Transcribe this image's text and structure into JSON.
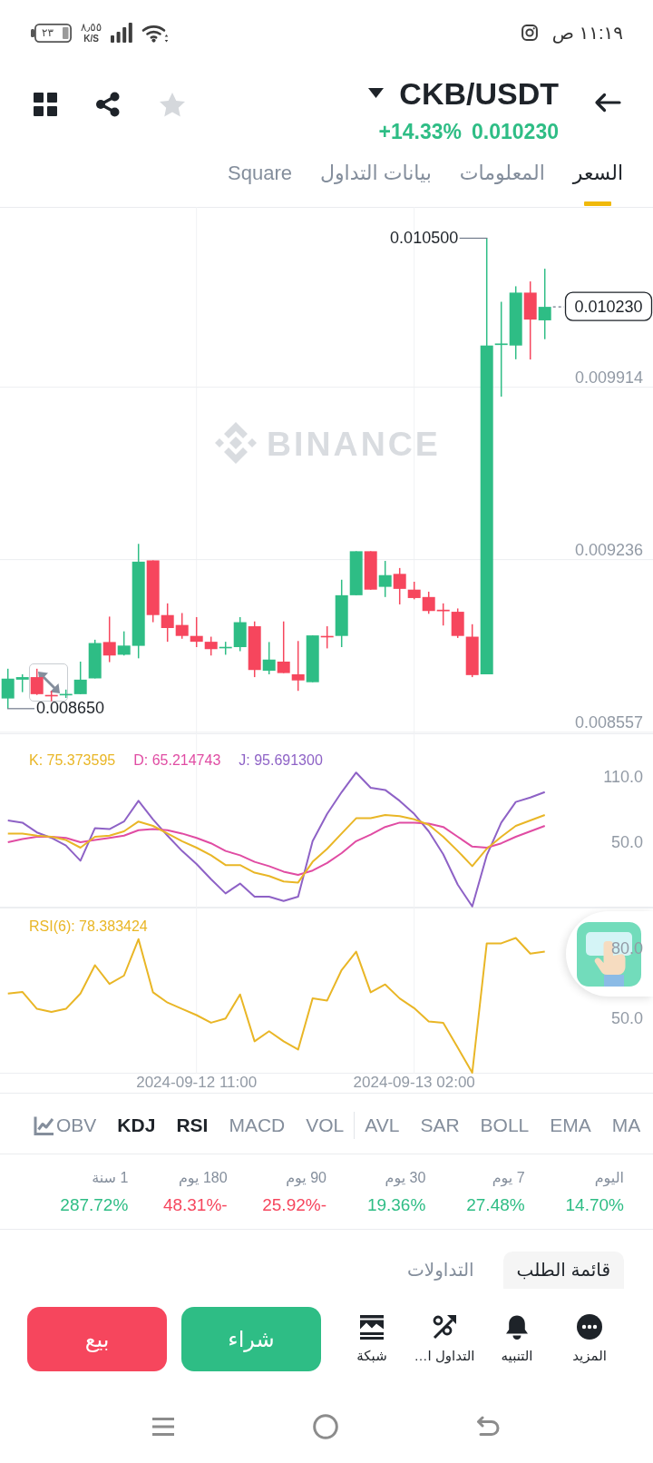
{
  "status_bar": {
    "time": "١١:١٩ ص",
    "battery": "٢٣",
    "network_speed": "٨٫٥٥",
    "network_speed_unit": "K/S"
  },
  "header": {
    "pair": "CKB/USDT",
    "change": "+14.33%",
    "price": "0.010230",
    "favorite": false
  },
  "tabs": [
    {
      "label": "السعر",
      "selected": true
    },
    {
      "label": "المعلومات",
      "selected": false
    },
    {
      "label": "بيانات التداول",
      "selected": false
    },
    {
      "label": "Square",
      "selected": false
    }
  ],
  "price_chart": {
    "watermark": "BINANCE",
    "high": "0.010500",
    "low": "0.008650",
    "last_price": "0.010230",
    "chart_data": {
      "type": "candlestick",
      "grid": true,
      "ylim": [
        0.008553,
        0.010623
      ],
      "yticks": [
        {
          "value": 0.009914,
          "label": "0.009914"
        },
        {
          "value": 0.009236,
          "label": "0.009236"
        },
        {
          "value": 0.008557,
          "label": "0.008557"
        }
      ],
      "ohlc": [
        [
          0.00869,
          0.008807,
          0.00865,
          0.008768
        ],
        [
          0.008764,
          0.008785,
          0.008715,
          0.008774
        ],
        [
          0.008774,
          0.008807,
          0.008704,
          0.008707
        ],
        [
          0.008704,
          0.00872,
          0.008679,
          0.0087
        ],
        [
          0.008704,
          0.008725,
          0.008692,
          0.008708
        ],
        [
          0.008707,
          0.008835,
          0.008707,
          0.008764
        ],
        [
          0.008769,
          0.008921,
          0.008769,
          0.008908
        ],
        [
          0.008912,
          0.009012,
          0.008833,
          0.008859
        ],
        [
          0.008862,
          0.008954,
          0.008859,
          0.008898
        ],
        [
          0.008897,
          0.009298,
          0.008848,
          0.009228
        ],
        [
          0.009233,
          0.009233,
          0.00899,
          0.009018
        ],
        [
          0.009018,
          0.009064,
          0.008913,
          0.008967
        ],
        [
          0.008979,
          0.009026,
          0.008925,
          0.008936
        ],
        [
          0.008936,
          0.00901,
          0.008892,
          0.008913
        ],
        [
          0.008913,
          0.008933,
          0.008859,
          0.008884
        ],
        [
          0.008888,
          0.008913,
          0.008862,
          0.008893
        ],
        [
          0.008892,
          0.00901,
          0.008876,
          0.00899
        ],
        [
          0.008974,
          0.008993,
          0.008774,
          0.008802
        ],
        [
          0.008799,
          0.008912,
          0.008785,
          0.008843
        ],
        [
          0.008835,
          0.008993,
          0.00879,
          0.00879
        ],
        [
          0.008785,
          0.008916,
          0.00872,
          0.008761
        ],
        [
          0.008754,
          0.008938,
          0.008754,
          0.008938
        ],
        [
          0.008936,
          0.008974,
          0.008887,
          0.008931
        ],
        [
          0.008936,
          0.009157,
          0.008892,
          0.009096
        ],
        [
          0.009096,
          0.009269,
          0.009096,
          0.009269
        ],
        [
          0.009269,
          0.009269,
          0.009118,
          0.009118
        ],
        [
          0.009129,
          0.009231,
          0.009089,
          0.009175
        ],
        [
          0.00918,
          0.009203,
          0.00906,
          0.009121
        ],
        [
          0.009118,
          0.009149,
          0.00908,
          0.009085
        ],
        [
          0.009089,
          0.00911,
          0.009023,
          0.009034
        ],
        [
          0.009039,
          0.009064,
          0.008977,
          0.009033
        ],
        [
          0.009031,
          0.009044,
          0.008928,
          0.008936
        ],
        [
          0.008933,
          0.008982,
          0.008774,
          0.008782
        ],
        [
          0.008785,
          0.0105,
          0.008785,
          0.010078
        ],
        [
          0.01008,
          0.01025,
          0.009877,
          0.010086
        ],
        [
          0.010078,
          0.010311,
          0.010024,
          0.010286
        ],
        [
          0.010286,
          0.01033,
          0.010023,
          0.01018
        ],
        [
          0.010177,
          0.01038,
          0.010103,
          0.01023
        ]
      ]
    }
  },
  "kdj": {
    "legend": [
      "J: 95.691300",
      "D: 65.214743",
      "K: 75.373595"
    ],
    "chart_data": {
      "type": "line",
      "grid": true,
      "ylim": [
        -10,
        150
      ],
      "yticks": [
        {
          "value": 50,
          "label": "50.0"
        },
        {
          "value": 110,
          "label": "110.0"
        }
      ],
      "series": [
        {
          "color": "#8e62c6",
          "values": [
            70,
            68,
            59,
            54,
            47,
            33,
            63,
            62,
            69,
            88,
            71,
            56,
            42,
            30,
            16,
            3,
            12,
            0,
            0,
            -4,
            0,
            51,
            76,
            96,
            114,
            100,
            98,
            88,
            76,
            60,
            39,
            11,
            -9,
            38,
            68,
            87,
            91,
            96
          ]
        },
        {
          "color": "#e04ca3",
          "values": [
            50,
            53,
            55,
            55,
            54,
            50,
            52,
            54,
            56,
            61,
            62,
            61,
            58,
            54,
            49,
            42,
            38,
            32,
            28,
            23,
            20,
            24,
            31,
            40,
            51,
            57,
            64,
            68,
            68,
            67,
            64,
            55,
            46,
            45,
            49,
            55,
            60,
            65
          ]
        },
        {
          "color": "#e9b626",
          "values": [
            58,
            58,
            56,
            55,
            52,
            45,
            55,
            56,
            60,
            69,
            65,
            58,
            51,
            45,
            38,
            29,
            29,
            22,
            19,
            14,
            13,
            32,
            44,
            58,
            72,
            72,
            75,
            74,
            71,
            66,
            55,
            42,
            28,
            44,
            55,
            65,
            70,
            75
          ]
        }
      ]
    }
  },
  "rsi": {
    "legend": "RSI(6): 78.383424",
    "chart_data": {
      "type": "line",
      "grid": true,
      "categories": [
        null,
        null,
        null,
        null,
        null,
        null,
        null,
        null,
        null,
        null,
        null,
        null,
        null,
        "2024-09-12 11:00",
        null,
        null,
        null,
        null,
        null,
        null,
        null,
        null,
        null,
        null,
        null,
        null,
        null,
        null,
        "2024-09-13 02:00",
        null,
        null,
        null,
        null,
        null,
        null,
        null,
        null,
        null
      ],
      "ylim": [
        25.9,
        97.4
      ],
      "yticks": [
        {
          "value": 50,
          "label": "50.0"
        },
        {
          "value": 80,
          "label": "80.0"
        }
      ],
      "series": [
        {
          "color": "#e9b626",
          "values": [
            60.4,
            61.1,
            53.8,
            52.5,
            53.8,
            60.4,
            72.6,
            64.5,
            68.1,
            83.8,
            60.9,
            56.5,
            53.8,
            51.1,
            47.8,
            49.6,
            60.0,
            39.8,
            44.2,
            39.8,
            36.3,
            58.3,
            57.4,
            70.5,
            78.4,
            60.9,
            64.3,
            58.3,
            54.1,
            48.4,
            47.8,
            37.1,
            26.3,
            82.0,
            82.0,
            84.3,
            77.6,
            78.4
          ]
        }
      ]
    }
  },
  "indicators": {
    "main": [
      {
        "label": "MA",
        "selected": false
      },
      {
        "label": "EMA",
        "selected": false
      },
      {
        "label": "BOLL",
        "selected": false
      },
      {
        "label": "SAR",
        "selected": false
      },
      {
        "label": "AVL",
        "selected": false
      }
    ],
    "sub": [
      {
        "label": "VOL",
        "selected": false
      },
      {
        "label": "MACD",
        "selected": false
      },
      {
        "label": "RSI",
        "selected": true
      },
      {
        "label": "KDJ",
        "selected": true
      },
      {
        "label": "OBV",
        "selected": false
      }
    ]
  },
  "performance": [
    {
      "period": "اليوم",
      "change": "14.70%",
      "color": "#2ebd85"
    },
    {
      "period": "7 يوم",
      "change": "27.48%",
      "color": "#2ebd85"
    },
    {
      "period": "30 يوم",
      "change": "19.36%",
      "color": "#2ebd85"
    },
    {
      "period": "90 يوم",
      "change": "-25.92%",
      "color": "#f6465d"
    },
    {
      "period": "180 يوم",
      "change": "-48.31%",
      "color": "#f6465d"
    },
    {
      "period": "1 سنة",
      "change": "287.72%",
      "color": "#2ebd85"
    }
  ],
  "order_tabs": [
    {
      "label": "قائمة الطلب",
      "selected": true
    },
    {
      "label": "التداولات",
      "selected": false
    }
  ],
  "actions": [
    "المزيد",
    "التنبيه",
    "التداول ا…",
    "شبكة"
  ],
  "buy_button": "شراء",
  "sell_button": "بيع"
}
